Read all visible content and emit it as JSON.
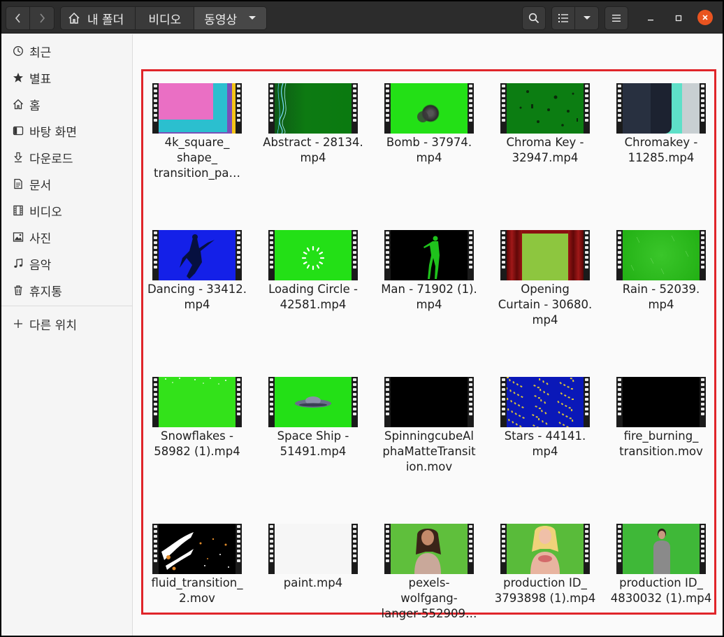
{
  "window": {
    "nav": {
      "back_icon": "chevron-left-icon",
      "forward_icon": "chevron-right-icon"
    },
    "breadcrumb": [
      {
        "label": "내 폴더",
        "icon": "home-icon"
      },
      {
        "label": "비디오"
      },
      {
        "label": "동영상"
      }
    ],
    "toolbar": {
      "search_icon": "search-icon",
      "view_icon": "list-view-icon",
      "view_menu_icon": "chevron-down-icon",
      "menu_icon": "hamburger-icon"
    },
    "controls": {
      "minimize": "minimize-icon",
      "maximize": "maximize-icon",
      "close": "close-icon"
    }
  },
  "sidebar": {
    "items": [
      {
        "label": "최근",
        "icon": "clock-icon"
      },
      {
        "label": "별표",
        "icon": "star-icon"
      },
      {
        "label": "홈",
        "icon": "home-icon"
      },
      {
        "label": "바탕 화면",
        "icon": "desktop-icon"
      },
      {
        "label": "다운로드",
        "icon": "download-icon"
      },
      {
        "label": "문서",
        "icon": "document-icon"
      },
      {
        "label": "비디오",
        "icon": "film-icon"
      },
      {
        "label": "사진",
        "icon": "image-icon"
      },
      {
        "label": "음악",
        "icon": "music-icon"
      },
      {
        "label": "휴지통",
        "icon": "trash-icon"
      }
    ],
    "other": {
      "label": "다른 위치",
      "icon": "plus-icon"
    }
  },
  "files": [
    {
      "lines": [
        "4k_square_",
        "shape_",
        "transition_pa…"
      ],
      "thumb": "4k"
    },
    {
      "lines": [
        "Abstract - 28134.",
        "mp4"
      ],
      "thumb": "abstract"
    },
    {
      "lines": [
        "Bomb - 37974.",
        "mp4"
      ],
      "thumb": "bomb"
    },
    {
      "lines": [
        "Chroma Key -",
        "32947.mp4"
      ],
      "thumb": "chromakey"
    },
    {
      "lines": [
        "Chromakey -",
        "11285.mp4"
      ],
      "thumb": "chromakey2"
    },
    {
      "lines": [
        "Dancing - 33412.",
        "mp4"
      ],
      "thumb": "dancing"
    },
    {
      "lines": [
        "Loading Circle -",
        "42581.mp4"
      ],
      "thumb": "loading"
    },
    {
      "lines": [
        "Man - 71902 (1).",
        "mp4"
      ],
      "thumb": "man"
    },
    {
      "lines": [
        "Opening",
        "Curtain - 30680.",
        "mp4"
      ],
      "thumb": "curtain"
    },
    {
      "lines": [
        "Rain - 52039.",
        "mp4"
      ],
      "thumb": "rain"
    },
    {
      "lines": [
        "Snowflakes -",
        "58982 (1).mp4"
      ],
      "thumb": "snow"
    },
    {
      "lines": [
        "Space Ship -",
        "51491.mp4"
      ],
      "thumb": "ship"
    },
    {
      "lines": [
        "SpinningcubeAl",
        "phaMatteTransit",
        "ion.mov"
      ],
      "thumb": "black"
    },
    {
      "lines": [
        "Stars - 44141.",
        "mp4"
      ],
      "thumb": "stars"
    },
    {
      "lines": [
        "fire_burning_",
        "transition.mov"
      ],
      "thumb": "black"
    },
    {
      "lines": [
        "fluid_transition_",
        "2.mov"
      ],
      "thumb": "fluid"
    },
    {
      "lines": [
        "paint.mp4"
      ],
      "thumb": "paint"
    },
    {
      "lines": [
        "pexels-",
        "wolfgang-",
        "langer-552909…"
      ],
      "thumb": "woman1"
    },
    {
      "lines": [
        "production ID_",
        "3793898 (1).mp4"
      ],
      "thumb": "woman2"
    },
    {
      "lines": [
        "production ID_",
        "4830032 (1).mp4"
      ],
      "thumb": "woman3"
    }
  ]
}
